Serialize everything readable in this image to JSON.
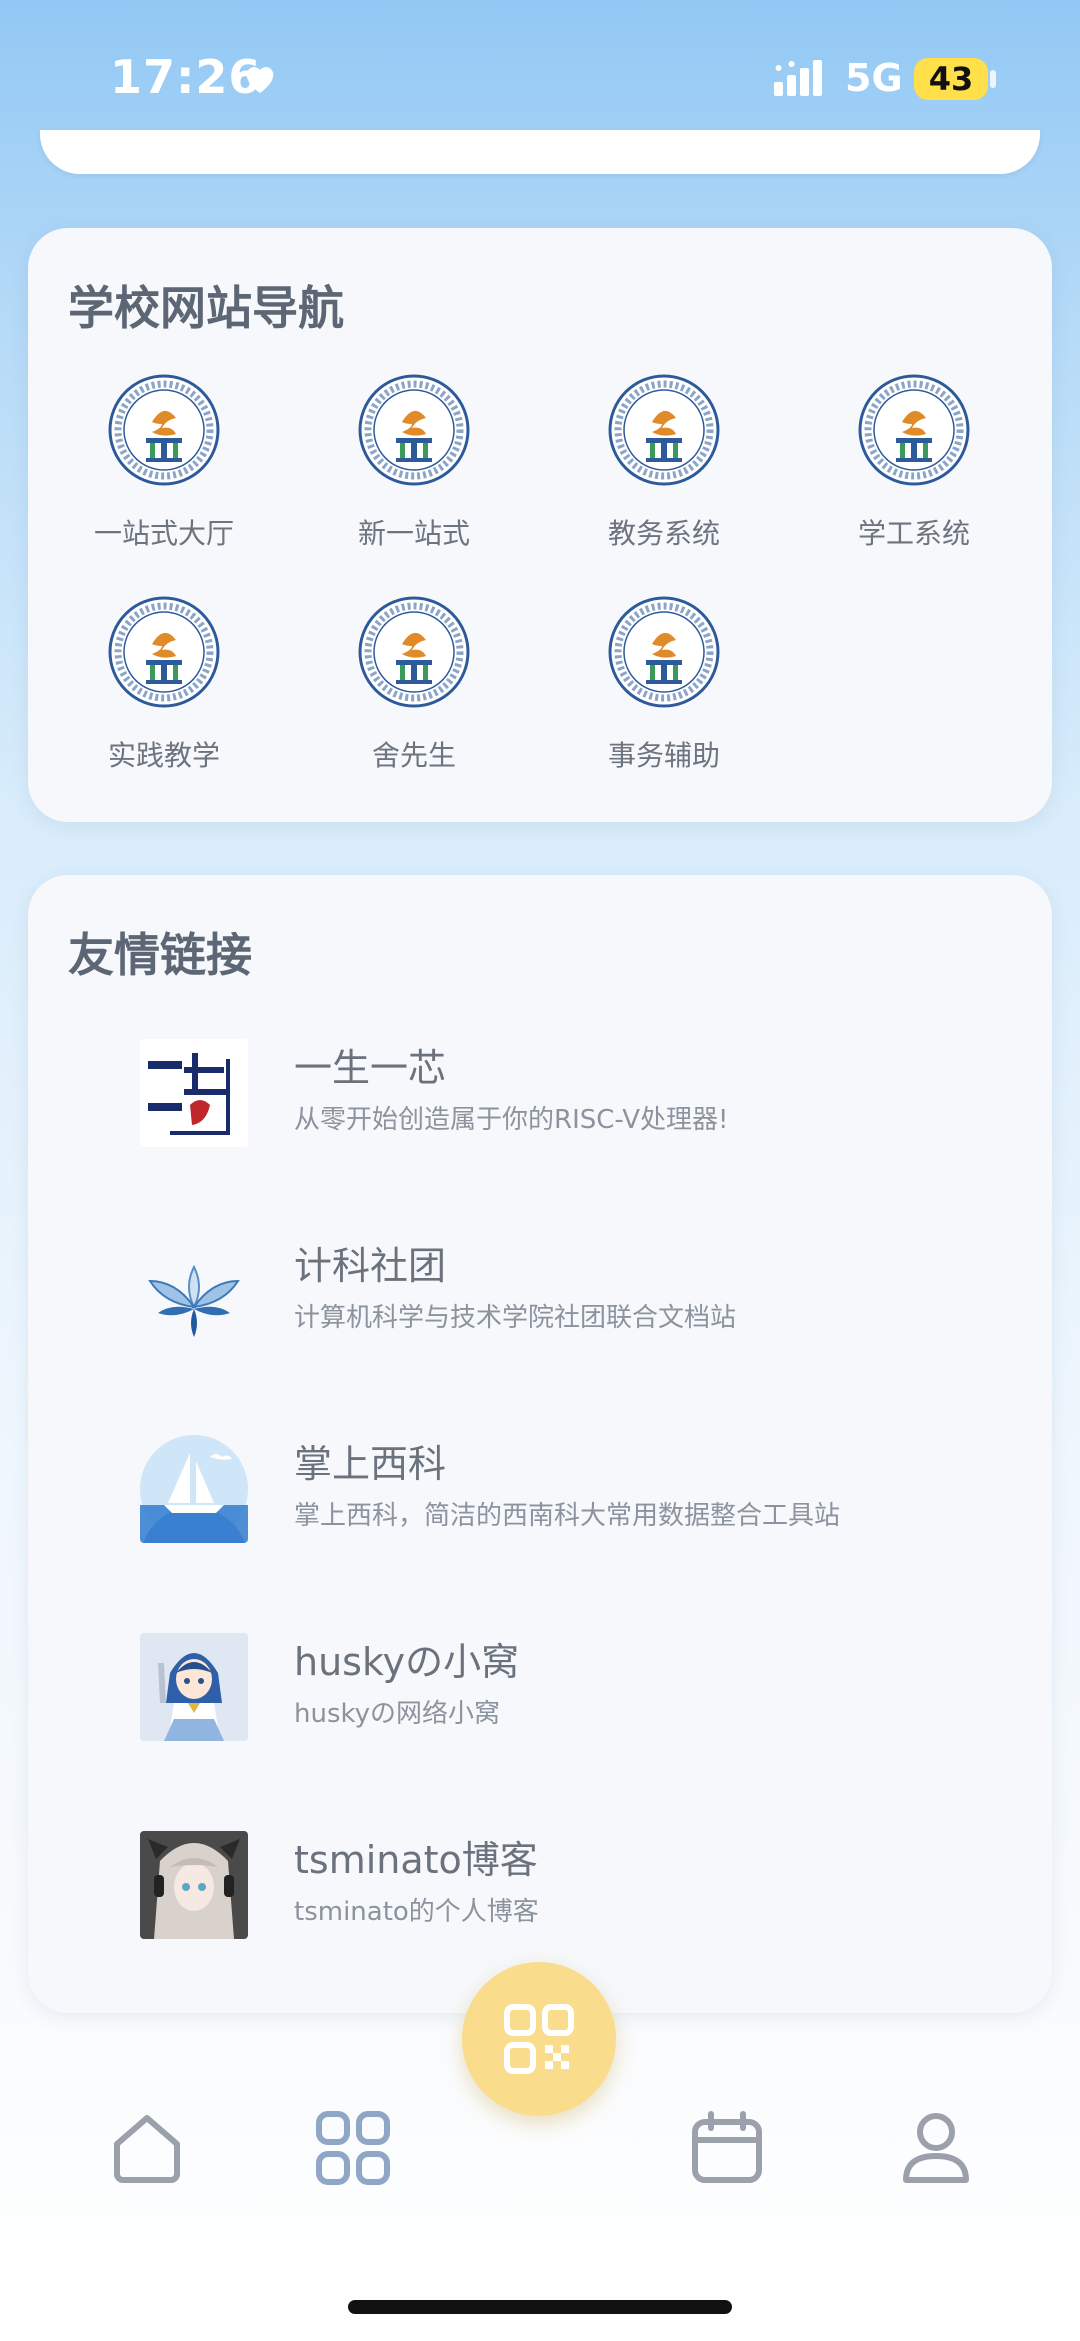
{
  "status_bar": {
    "time": "17:26",
    "network": "5G",
    "battery": "43",
    "heart_icon": "heart-icon",
    "signal_icon": "signal-icon"
  },
  "school_nav": {
    "title": "学校网站导航",
    "items": [
      {
        "label": "一站式大厅",
        "icon": "school-logo-icon"
      },
      {
        "label": "新一站式",
        "icon": "school-logo-icon"
      },
      {
        "label": "教务系统",
        "icon": "school-logo-icon"
      },
      {
        "label": "学工系统",
        "icon": "school-logo-icon"
      },
      {
        "label": "实践教学",
        "icon": "school-logo-icon"
      },
      {
        "label": "舍先生",
        "icon": "school-logo-icon"
      },
      {
        "label": "事务辅助",
        "icon": "school-logo-icon"
      }
    ]
  },
  "friend_links": {
    "title": "友情链接",
    "items": [
      {
        "title": "一生一芯",
        "subtitle": "从零开始创造属于你的RISC-V处理器!",
        "icon": "ysyx-logo-icon"
      },
      {
        "title": "计科社团",
        "subtitle": "计算机科学与技术学院社团联合文档站",
        "icon": "lotus-logo-icon"
      },
      {
        "title": "掌上西科",
        "subtitle": "掌上西科，简洁的西南科大常用数据整合工具站",
        "icon": "sailboat-logo-icon"
      },
      {
        "title": "huskyの小窝",
        "subtitle": "huskyの网络小窝",
        "icon": "anime-avatar-icon"
      },
      {
        "title": "tsminato博客",
        "subtitle": "tsminato的个人博客",
        "icon": "anime-avatar-gray-icon"
      }
    ]
  },
  "tab_bar": {
    "items": [
      {
        "name": "home",
        "icon": "home-icon"
      },
      {
        "name": "apps",
        "icon": "grid-icon"
      },
      {
        "name": "scan",
        "icon": "qr-code-icon"
      },
      {
        "name": "calendar",
        "icon": "calendar-icon"
      },
      {
        "name": "profile",
        "icon": "person-icon"
      }
    ]
  },
  "colors": {
    "accent_fab": "#f9dc8c",
    "logo_blue": "#2d5a9a",
    "logo_orange": "#e08a2a",
    "logo_green": "#3a9a5a"
  }
}
